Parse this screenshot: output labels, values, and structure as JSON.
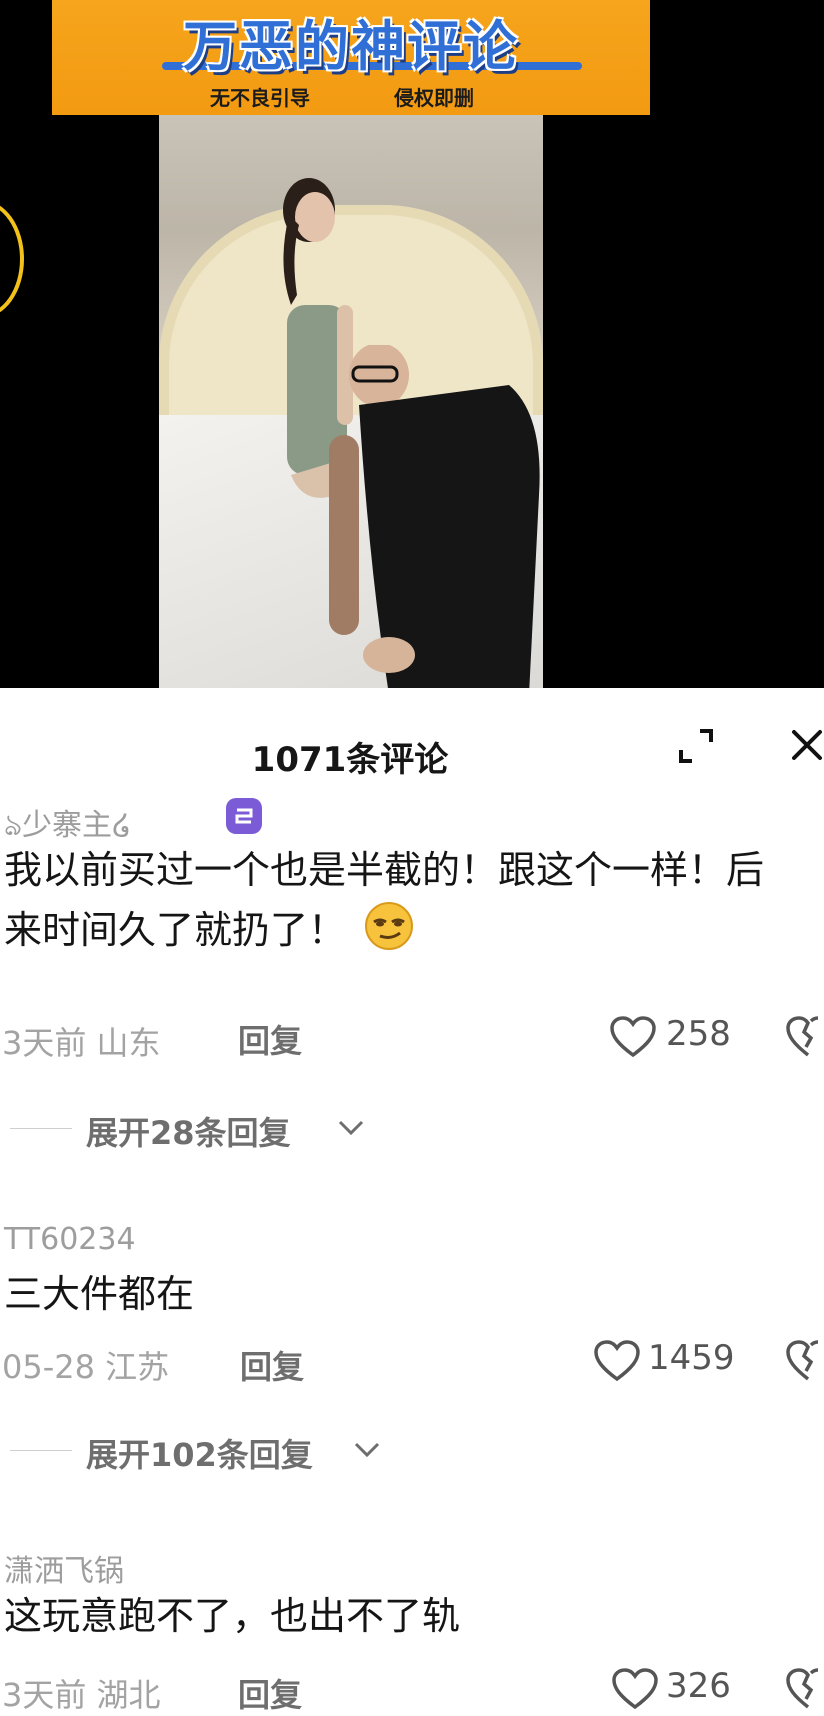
{
  "video": {
    "banner_title": "万恶的神评论",
    "banner_left": "无不良引导",
    "banner_right": "侵权即删"
  },
  "panel": {
    "title": "1071条评论"
  },
  "comments": [
    {
      "username": "ঌ少寨主໒",
      "text": "我以前买过一个也是半截的！跟这个一样！后来时间久了就扔了！",
      "time_loc": "3天前 山东",
      "reply": "回复",
      "likes": "258",
      "expand": "展开28条回复"
    },
    {
      "username": "TT60234",
      "text": "三大件都在",
      "time_loc": "05-28 江苏",
      "reply": "回复",
      "likes": "1459",
      "expand": "展开102条回复"
    },
    {
      "username": "潇洒飞锅",
      "text": "这玩意跑不了，也出不了轨",
      "time_loc": "3天前 湖北",
      "reply": "回复",
      "likes": "326"
    }
  ],
  "colors": {
    "banner": "#f29a12",
    "banner_title": "#2f6fd6",
    "badge": "#7c5cd6"
  }
}
